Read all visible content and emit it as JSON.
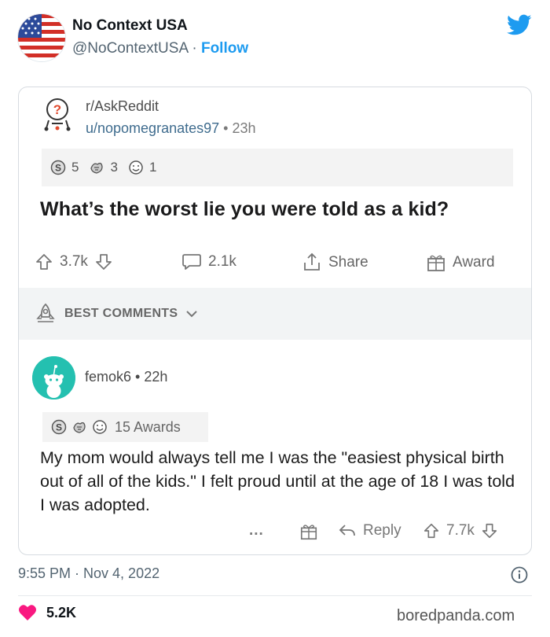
{
  "tweet": {
    "display_name": "No Context USA",
    "handle": "@NoContextUSA",
    "separator": " · ",
    "follow_label": "Follow",
    "timestamp": "9:55 PM · Nov 4, 2022",
    "likes": "5.2K",
    "brand_color": "#1d9bf0"
  },
  "reddit": {
    "subreddit": "r/AskReddit",
    "author": "u/nopomegranates97",
    "meta_sep": " • ",
    "age": "23h",
    "awards": [
      {
        "icon": "silver-award-icon",
        "count": "5"
      },
      {
        "icon": "helpful-award-icon",
        "count": "3"
      },
      {
        "icon": "wholesome-award-icon",
        "count": "1"
      }
    ],
    "title": "What’s the worst lie you were told as a kid?",
    "upvotes": "3.7k",
    "comments": "2.1k",
    "share_label": "Share",
    "award_label": "Award",
    "sort_label": "BEST COMMENTS",
    "comment": {
      "author": "femok6",
      "meta_sep": " • ",
      "age": "22h",
      "awards_label": "15 Awards",
      "body": "My mom would always tell me I was the \"easiest physical birth out of all of the kids.\" I felt proud until at the age of 18 I was told I was adopted.",
      "more_label": "...",
      "reply_label": "Reply",
      "score": "7.7k"
    }
  },
  "watermark": "boredpanda.com"
}
